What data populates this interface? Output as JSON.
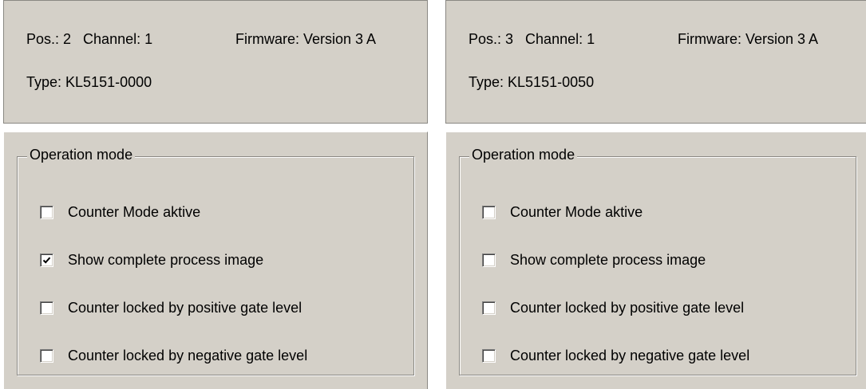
{
  "panels": [
    {
      "pos_label": "Pos.: 2",
      "channel_label": "Channel: 1",
      "firmware_label": "Firmware: Version 3 A",
      "type_label": "Type: KL5151-0000",
      "group_title": "Operation mode",
      "options": [
        {
          "label": "Counter Mode aktive",
          "checked": false
        },
        {
          "label": "Show complete process image",
          "checked": true
        },
        {
          "label": "Counter locked by positive gate level",
          "checked": false
        },
        {
          "label": "Counter locked by negative gate level",
          "checked": false
        }
      ]
    },
    {
      "pos_label": "Pos.: 3",
      "channel_label": "Channel: 1",
      "firmware_label": "Firmware: Version 3 A",
      "type_label": "Type: KL5151-0050",
      "group_title": "Operation mode",
      "options": [
        {
          "label": "Counter Mode aktive",
          "checked": false
        },
        {
          "label": "Show complete process image",
          "checked": false
        },
        {
          "label": "Counter locked by positive gate level",
          "checked": false
        },
        {
          "label": "Counter locked by negative gate level",
          "checked": false
        }
      ]
    }
  ],
  "icons": {
    "checkbox_checked": "check-mark-icon"
  },
  "colors": {
    "panel_bg": "#d4d0c8",
    "border_dark": "#8a8883"
  }
}
